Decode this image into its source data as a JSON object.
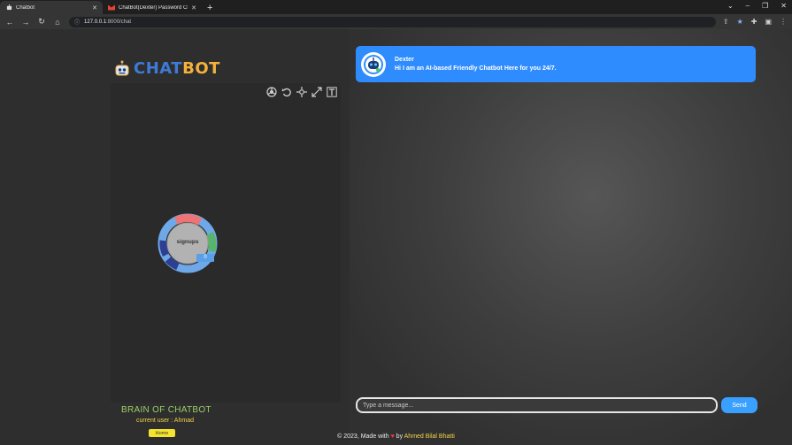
{
  "browser": {
    "tabs": [
      {
        "title": "Chatbot",
        "active": true
      },
      {
        "title": "ChatBot(Dexter) Password Chang",
        "active": false
      }
    ],
    "url_host": "127.0.0.1",
    "url_path": ":8000/chat"
  },
  "sidebar": {
    "logo_part1": "CHAT",
    "logo_part2": "BOT",
    "graph_center_label": "signups",
    "graph_badge": "0",
    "brain_title": "BRAIN OF CHATBOT",
    "current_user": "current user : Ahmad",
    "home_label": "Home"
  },
  "chat": {
    "bot_name": "Dexter",
    "bot_message": "Hi I am an AI-based Friendly Chatbot Here for you 24/7.",
    "input_placeholder": "Type a message...",
    "input_value": "",
    "send_label": "Send"
  },
  "footer": {
    "prefix": "© 2023, Made with",
    "by": "by",
    "author": "Ahmed Bilal Bhatti"
  },
  "colors": {
    "accent_blue": "#2f8cff",
    "send_blue": "#3aa0ff",
    "brain_green": "#9ccc65",
    "user_yellow": "#f5d547",
    "home_yellow": "#f5e42d"
  }
}
